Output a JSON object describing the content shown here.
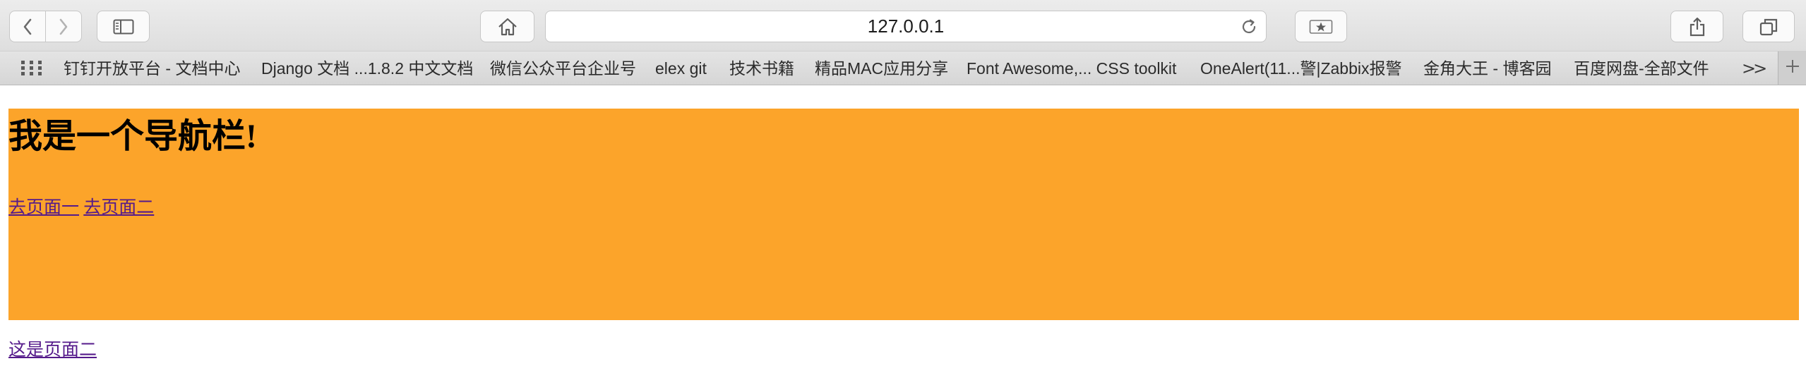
{
  "browser": {
    "address": "127.0.0.1",
    "bookmarks": [
      "钉钉开放平台 - 文档中心",
      "Django 文档 ...1.8.2 中文文档",
      "微信公众平台企业号",
      "elex git",
      "技术书籍",
      "精品MAC应用分享",
      "Font Awesome,... CSS toolkit",
      "OneAlert(11...警|Zabbix报警",
      "金角大王 - 博客园",
      "百度网盘-全部文件"
    ],
    "more_label": ">>",
    "icons": {
      "back": "chevron-left-icon",
      "forward": "chevron-right-icon",
      "sidebar": "sidebar-icon",
      "home": "home-icon",
      "reload": "reload-icon",
      "reader": "star-icon",
      "share": "share-icon",
      "tabs": "tabs-icon",
      "apps": "grid-icon",
      "new_tab": "plus-icon"
    }
  },
  "page": {
    "navbar": {
      "title": "我是一个导航栏!",
      "links": [
        "去页面一",
        "去页面二"
      ],
      "background": "#fca42a"
    },
    "content_link": "这是页面二",
    "link_color": "#551a8b"
  }
}
